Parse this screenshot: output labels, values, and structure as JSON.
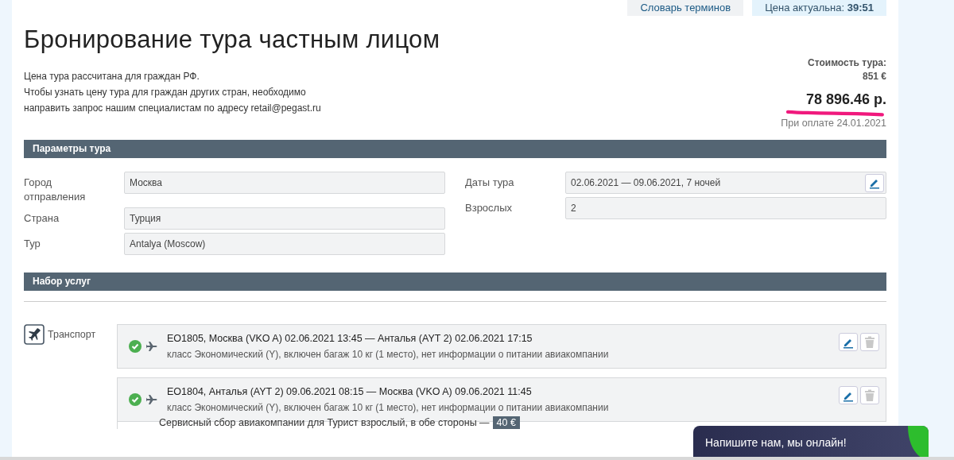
{
  "top_links": [
    {
      "kind": "plain",
      "label": "Словарь терминов"
    },
    {
      "kind": "timer",
      "label": "Цена актуальна:",
      "value": "39:51"
    }
  ],
  "title": "Бронирование тура частным лицом",
  "notes": [
    "Цена тура рассчитана для граждан РФ.",
    "Чтобы узнать цену тура для граждан других стран, необходимо",
    "направить запрос нашим специалистам по адресу retail@pegast.ru"
  ],
  "price": {
    "label": "Стоимость тура:",
    "eur": "851 €",
    "rub": "78 896.46 р.",
    "payment_note": "При оплате 24.01.2021"
  },
  "params": {
    "title": "Параметры тура",
    "left": [
      {
        "label": "Город отправления",
        "value": "Москва",
        "editable": false
      },
      {
        "label": "Страна",
        "value": "Турция",
        "editable": false
      },
      {
        "label": "Тур",
        "value": "Antalya (Moscow)",
        "editable": false
      }
    ],
    "right": [
      {
        "label": "Даты тура",
        "value": "02.06.2021 — 09.06.2021, 7  ночей",
        "editable": true
      },
      {
        "label": "Взрослых",
        "value": "2",
        "editable": false
      }
    ]
  },
  "services": {
    "title": "Набор услуг",
    "groups": [
      {
        "label": "Транспорт",
        "items": [
          {
            "confirmed": true,
            "route": "EO1805, Москва (VKO A) 02.06.2021 13:45 — Анталья (AYT 2) 02.06.2021 17:15",
            "details": "класс Экономический (Y), включен багаж 10 кг (1 место), нет информации о питании авиакомпании",
            "delete_disabled": true
          },
          {
            "confirmed": true,
            "route": "EO1804, Анталья (AYT 2) 09.06.2021 08:15 — Москва (VKO A) 09.06.2021 11:45",
            "details": "класс Экономический (Y), включен багаж 10 кг (1 место), нет информации о питании авиакомпании",
            "delete_disabled": true
          }
        ],
        "fees": [
          {
            "text": "Сервисный сбор авиакомпании для Турист взрослый, в обе стороны —",
            "amount": "40 €"
          }
        ]
      }
    ]
  },
  "chat": {
    "text": "Напишите нам, мы онлайн!"
  }
}
